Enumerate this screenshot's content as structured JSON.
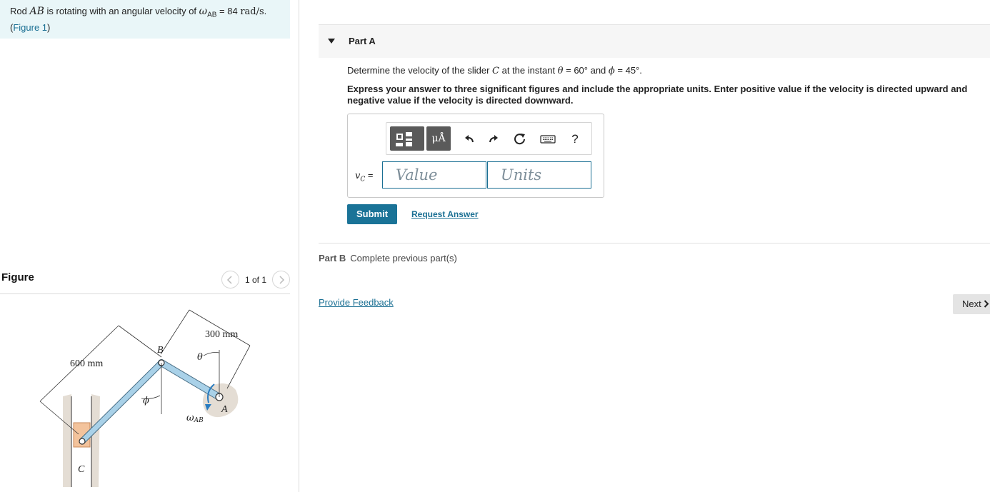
{
  "intro": {
    "prefix": "Rod ",
    "rod": "AB",
    "middle": " is rotating with an angular velocity of ",
    "omega_symbol": "ω",
    "omega_sub": "AB",
    "equals": " = 84 ",
    "unit": "rad/s",
    "suffix": ".",
    "figure_link": "Figure 1",
    "paren_open": "(",
    "paren_close": ")"
  },
  "figure_panel": {
    "title": "Figure",
    "pager_text": "1 of 1",
    "prev_icon": "chevron-left-icon",
    "next_icon": "chevron-right-icon",
    "labels": {
      "dim_300": "300 mm",
      "dim_600": "600 mm",
      "point_b": "B",
      "point_a": "A",
      "point_c": "C",
      "theta": "θ",
      "phi": "ϕ",
      "omega": "ω",
      "omega_sub": "AB"
    }
  },
  "part_a": {
    "title": "Part A",
    "question_prefix": "Determine the velocity of the slider ",
    "slider": "C",
    "question_mid": " at the instant ",
    "theta_sym": "θ",
    "theta_val": " = 60°",
    "and_text": "  and ",
    "phi_sym": "ϕ",
    "phi_val": " = 45°",
    "period": ".",
    "instructions": "Express your answer to three significant figures and include the appropriate units. Enter positive value if the velocity is directed upward and negative value if the velocity is directed downward.",
    "toolbar": {
      "units_label": "μÅ",
      "help_label": "?",
      "icons": [
        "templates-icon",
        "units-icon",
        "undo-icon",
        "redo-icon",
        "reset-icon",
        "keyboard-icon",
        "help-icon"
      ]
    },
    "answer_label_var": "v",
    "answer_label_sub": "C",
    "answer_label_eq": " =",
    "value_placeholder": "Value",
    "units_placeholder": "Units",
    "submit_label": "Submit",
    "request_answer_label": "Request Answer"
  },
  "part_b": {
    "title": "Part B",
    "note": "Complete previous part(s)"
  },
  "footer": {
    "feedback_label": "Provide Feedback",
    "next_label": "Next",
    "next_icon": "chevron-right-icon"
  },
  "colors": {
    "accent": "#1a7397",
    "link": "#1a6f93",
    "intro_bg": "#e9f6f8",
    "rod": "#9fc9e0",
    "slider": "#f3c39c"
  }
}
